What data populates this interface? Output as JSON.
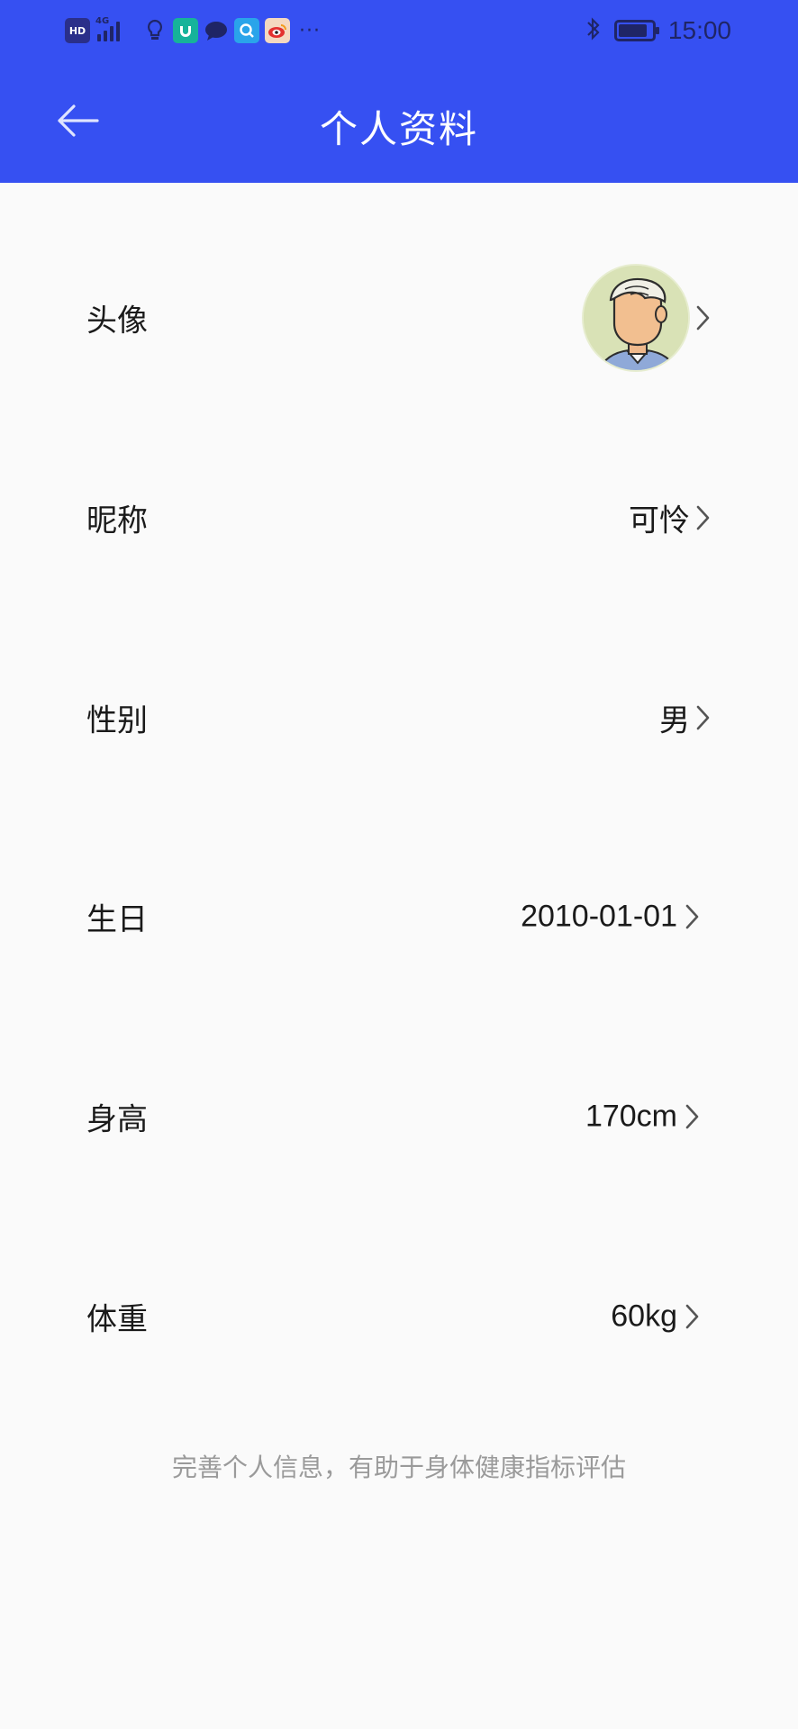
{
  "status_bar": {
    "time": "15:00",
    "icons": [
      "hd-icon",
      "signal-4g-icon",
      "bulb-icon",
      "mi-icon",
      "chat-icon",
      "search-app-icon",
      "weibo-icon",
      "more-icon",
      "bluetooth-icon",
      "battery-icon"
    ],
    "hd_text": "HD",
    "net_text": "4G",
    "more_text": "···",
    "battery_level": 0.85
  },
  "header": {
    "title": "个人资料",
    "back_icon": "arrow-left-icon",
    "background": "#3650f2"
  },
  "profile": {
    "rows": [
      {
        "key": "avatar",
        "label": "头像",
        "value": ""
      },
      {
        "key": "nickname",
        "label": "昵称",
        "value": "可怜"
      },
      {
        "key": "gender",
        "label": "性别",
        "value": "男"
      },
      {
        "key": "birthday",
        "label": "生日",
        "value": "2010-01-01"
      },
      {
        "key": "height",
        "label": "身高",
        "value": "170cm"
      },
      {
        "key": "weight",
        "label": "体重",
        "value": "60kg"
      }
    ],
    "hint": "完善个人信息，有助于身体健康指标评估"
  }
}
